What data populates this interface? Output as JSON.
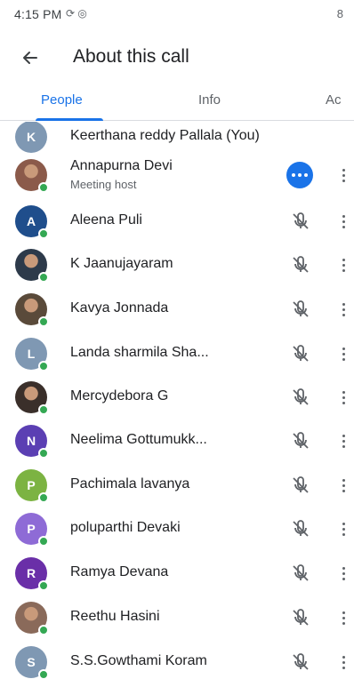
{
  "status_bar": {
    "time": "4:15 PM",
    "icons": "⟳ ◎",
    "battery": "8"
  },
  "app_bar": {
    "title": "About this call"
  },
  "tabs": [
    {
      "label": "People",
      "active": true
    },
    {
      "label": "Info",
      "active": false
    },
    {
      "label": "Ac",
      "active": false
    }
  ],
  "participants": [
    {
      "name": "Keerthana reddy Pallala (You)",
      "initial": "K",
      "avatar_color": "#7f98b3",
      "photo": false,
      "subtitle": "",
      "state": "none"
    },
    {
      "name": "Annapurna Devi",
      "initial": "",
      "avatar_color": "#8b5a4a",
      "photo": true,
      "subtitle": "Meeting host",
      "state": "host"
    },
    {
      "name": "Aleena Puli",
      "initial": "A",
      "avatar_color": "#1f4e8c",
      "photo": false,
      "subtitle": "",
      "state": "muted"
    },
    {
      "name": "K Jaanujayaram",
      "initial": "",
      "avatar_color": "#2d3a4a",
      "photo": true,
      "subtitle": "",
      "state": "muted"
    },
    {
      "name": "Kavya Jonnada",
      "initial": "",
      "avatar_color": "#5a4a3a",
      "photo": true,
      "subtitle": "",
      "state": "muted"
    },
    {
      "name": "Landa sharmila Sha...",
      "initial": "L",
      "avatar_color": "#7f98b3",
      "photo": false,
      "subtitle": "",
      "state": "muted"
    },
    {
      "name": "Mercydebora G",
      "initial": "",
      "avatar_color": "#3a2f2a",
      "photo": true,
      "subtitle": "",
      "state": "muted"
    },
    {
      "name": "Neelima Gottumukk...",
      "initial": "N",
      "avatar_color": "#5b3fb3",
      "photo": false,
      "subtitle": "",
      "state": "muted"
    },
    {
      "name": "Pachimala lavanya",
      "initial": "P",
      "avatar_color": "#7cb342",
      "photo": false,
      "subtitle": "",
      "state": "muted"
    },
    {
      "name": "poluparthi Devaki",
      "initial": "P",
      "avatar_color": "#8e6bd6",
      "photo": false,
      "subtitle": "",
      "state": "muted"
    },
    {
      "name": "Ramya Devana",
      "initial": "R",
      "avatar_color": "#6a2fa8",
      "photo": false,
      "subtitle": "",
      "state": "muted"
    },
    {
      "name": "Reethu Hasini",
      "initial": "",
      "avatar_color": "#8a6a5a",
      "photo": true,
      "subtitle": "",
      "state": "muted"
    },
    {
      "name": "S.S.Gowthami Koram",
      "initial": "S",
      "avatar_color": "#7f98b3",
      "photo": false,
      "subtitle": "",
      "state": "muted"
    }
  ],
  "colors": {
    "accent": "#1a73e8",
    "online": "#34a853"
  }
}
